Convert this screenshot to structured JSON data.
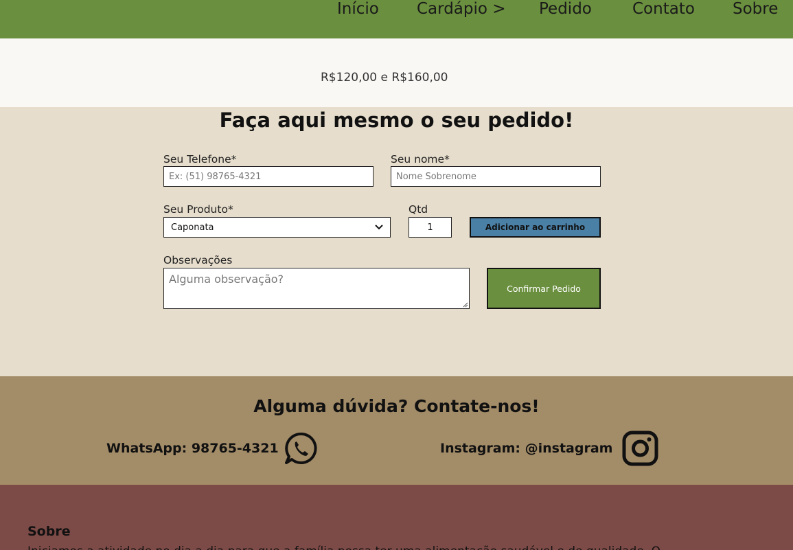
{
  "nav": {
    "items": [
      "Início",
      "Cardápio >",
      "Pedido",
      "Contato",
      "Sobre"
    ]
  },
  "top": {
    "price_range": "R$120,00 e R$160,00"
  },
  "order": {
    "title": "Faça aqui mesmo o seu pedido!",
    "phone_label": "Seu Telefone*",
    "phone_placeholder": "Ex: (51) 98765-4321",
    "name_label": "Seu nome*",
    "name_placeholder": "Nome Sobrenome",
    "product_label": "Seu Produto*",
    "product_value": "Caponata",
    "qty_label": "Qtd",
    "qty_value": "1",
    "add_button": "Adicionar ao carrinho",
    "notes_label": "Observações",
    "notes_placeholder": "Alguma observação?",
    "confirm_button": "Confirmar Pedido"
  },
  "contact": {
    "title": "Alguma dúvida? Contate-nos!",
    "whatsapp": "WhatsApp: 98765-4321",
    "instagram": "Instagram: @instagram"
  },
  "footer": {
    "title": "Sobre",
    "text": "Iniciamos a atividade no dia a dia para que a família possa ter uma alimentação saudável e de qualidade. O"
  },
  "colors": {
    "nav": "#6a8f3e",
    "order_bg": "#e6ddcc",
    "contact_bg": "#a38c68",
    "footer_bg": "#7d4b47",
    "add_button": "#4a7fa6",
    "confirm_button": "#6a8f3e"
  }
}
